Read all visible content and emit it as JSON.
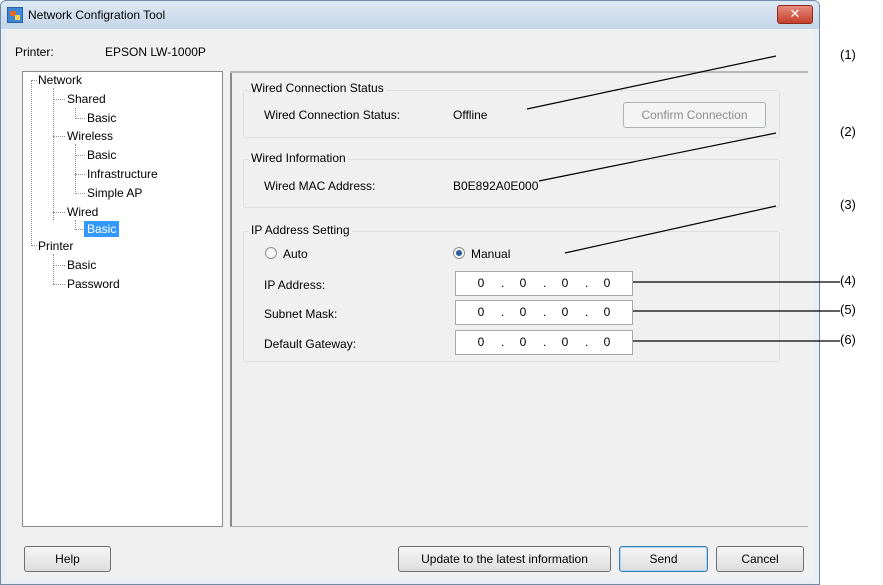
{
  "window": {
    "title": "Network Configration Tool",
    "close_glyph": "✕",
    "printer_label": "Printer:",
    "printer_name": "EPSON LW-1000P"
  },
  "tree": {
    "network": "Network",
    "shared": "Shared",
    "shared_basic": "Basic",
    "wireless": "Wireless",
    "wireless_basic": "Basic",
    "infrastructure": "Infrastructure",
    "simple_ap": "Simple AP",
    "wired": "Wired",
    "wired_basic": "Basic",
    "printer": "Printer",
    "printer_basic": "Basic",
    "password": "Password"
  },
  "wired_status": {
    "group_title": "Wired Connection Status",
    "label": "Wired Connection Status:",
    "value": "Offline",
    "confirm_button": "Confirm Connection"
  },
  "wired_info": {
    "group_title": "Wired Information",
    "mac_label": "Wired MAC Address:",
    "mac_value": "B0E892A0E000"
  },
  "ip_setting": {
    "group_title": "IP Address Setting",
    "auto_label": "Auto",
    "manual_label": "Manual",
    "selected": "Manual",
    "ip_label": "IP Address:",
    "ip_octets": [
      "0",
      "0",
      "0",
      "0"
    ],
    "subnet_label": "Subnet Mask:",
    "subnet_octets": [
      "0",
      "0",
      "0",
      "0"
    ],
    "gateway_label": "Default Gateway:",
    "gateway_octets": [
      "0",
      "0",
      "0",
      "0"
    ],
    "separator": "."
  },
  "buttons": {
    "help": "Help",
    "update": "Update to the latest information",
    "send": "Send",
    "cancel": "Cancel"
  },
  "callouts": [
    "(1)",
    "(2)",
    "(3)",
    "(4)",
    "(5)",
    "(6)"
  ],
  "colors": {
    "selection": "#3399ff",
    "close_button": "#c3402c",
    "radio_dot": "#2b5d9a"
  }
}
